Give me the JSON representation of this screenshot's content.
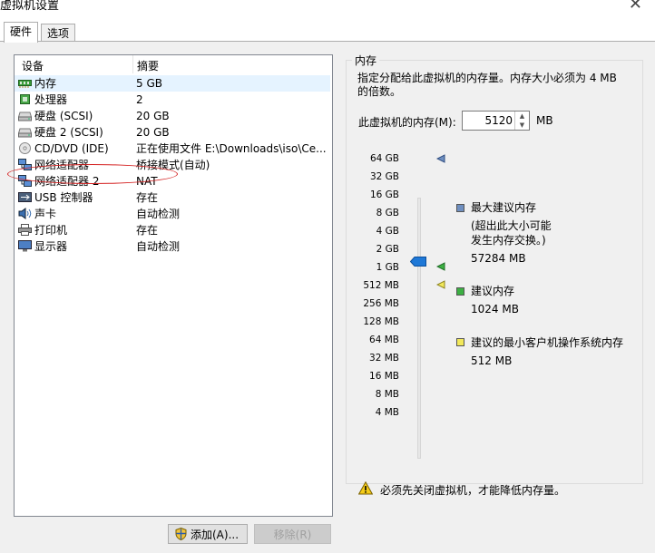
{
  "window": {
    "title": "虚拟机设置",
    "close_glyph": "✕"
  },
  "tabs": [
    {
      "label": "硬件"
    },
    {
      "label": "选项"
    }
  ],
  "device_list": {
    "headers": {
      "device": "设备",
      "summary": "摘要"
    },
    "rows": [
      {
        "name": "内存",
        "summary": "5 GB",
        "icon": "memory-icon",
        "selected": true
      },
      {
        "name": "处理器",
        "summary": "2",
        "icon": "cpu-icon"
      },
      {
        "name": "硬盘 (SCSI)",
        "summary": "20 GB",
        "icon": "hard-disk-icon"
      },
      {
        "name": "硬盘 2 (SCSI)",
        "summary": "20 GB",
        "icon": "hard-disk-icon",
        "circled": true
      },
      {
        "name": "CD/DVD (IDE)",
        "summary": "正在使用文件 E:\\Downloads\\iso\\Ce...",
        "icon": "cd-dvd-icon"
      },
      {
        "name": "网络适配器",
        "summary": "桥接模式(自动)",
        "icon": "network-adapter-icon"
      },
      {
        "name": "网络适配器 2",
        "summary": "NAT",
        "icon": "network-adapter-icon"
      },
      {
        "name": "USB 控制器",
        "summary": "存在",
        "icon": "usb-icon"
      },
      {
        "name": "声卡",
        "summary": "自动检测",
        "icon": "sound-card-icon"
      },
      {
        "name": "打印机",
        "summary": "存在",
        "icon": "printer-icon"
      },
      {
        "name": "显示器",
        "summary": "自动检测",
        "icon": "display-icon"
      }
    ]
  },
  "buttons": {
    "add": "添加(A)...",
    "remove": "移除(R)"
  },
  "memory": {
    "group_title": "内存",
    "description": "指定分配给此虚拟机的内存量。内存大小必须为 4 MB 的倍数。",
    "label": "此虚拟机的内存(M):",
    "value": "5120",
    "unit": "MB",
    "scale": [
      "64 GB",
      "32 GB",
      "16 GB",
      "8 GB",
      "4 GB",
      "2 GB",
      "1 GB",
      "512 MB",
      "256 MB",
      "128 MB",
      "64 MB",
      "32 MB",
      "16 MB",
      "8 MB",
      "4 MB"
    ],
    "legend": {
      "max": {
        "title": "最大建议内存",
        "note_line1": "(超出此大小可能",
        "note_line2": "发生内存交换。)",
        "value": "57284 MB",
        "color": "#6f8fc0"
      },
      "recommended": {
        "title": "建议内存",
        "value": "1024 MB",
        "color": "#3cb043"
      },
      "min_guest": {
        "title": "建议的最小客户机操作系统内存",
        "value": "512 MB",
        "color": "#f2e85a"
      }
    },
    "warning": "必须先关闭虚拟机，才能降低内存量。"
  }
}
